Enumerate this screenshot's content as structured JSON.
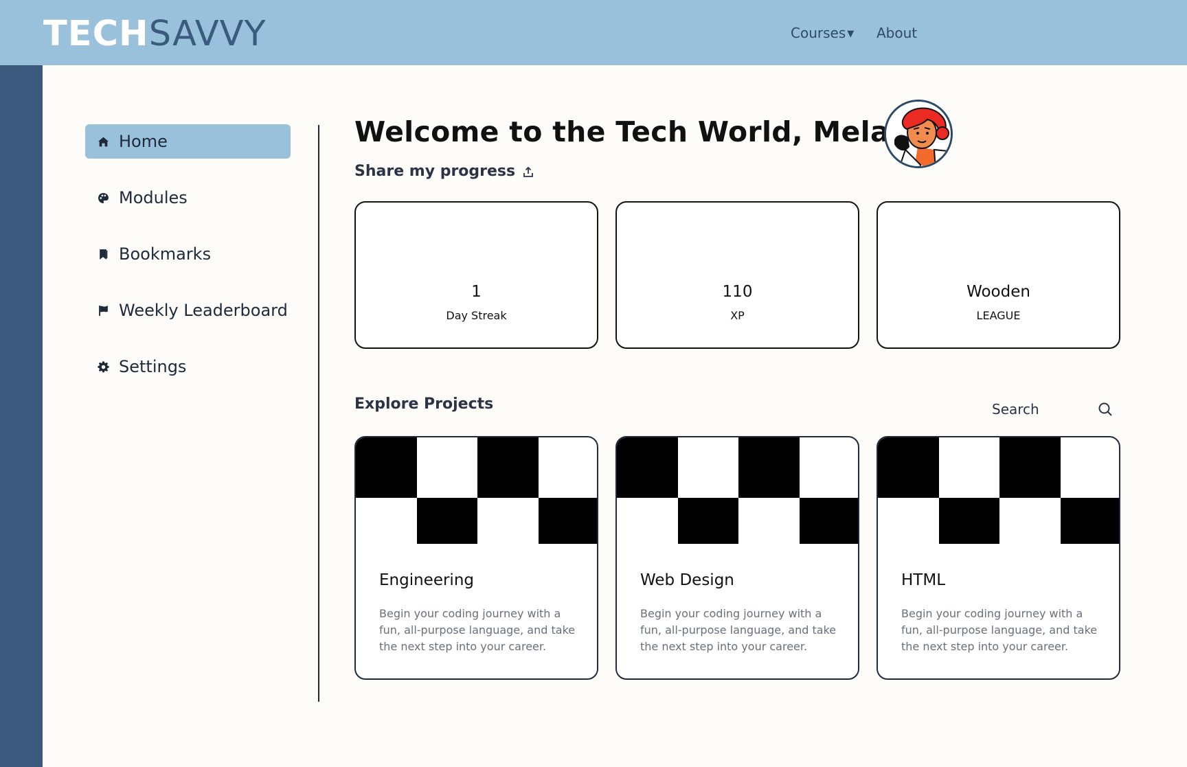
{
  "header": {
    "logo_part1": "TECH",
    "logo_part2": "SAVVY",
    "nav": {
      "courses": "Courses",
      "about": "About"
    }
  },
  "sidebar": {
    "items": [
      {
        "label": "Home",
        "icon": "home-icon"
      },
      {
        "label": "Modules",
        "icon": "palette-icon"
      },
      {
        "label": "Bookmarks",
        "icon": "bookmark-icon"
      },
      {
        "label": "Weekly Leaderboard",
        "icon": "flag-icon"
      },
      {
        "label": "Settings",
        "icon": "gear-icon"
      }
    ]
  },
  "main": {
    "welcome": "Welcome to the Tech World, Melanie!",
    "share_label": "Share my progress",
    "stats": [
      {
        "value": "1",
        "label": "Day Streak"
      },
      {
        "value": "110",
        "label": "XP"
      },
      {
        "value": "Wooden",
        "label": "LEAGUE"
      }
    ],
    "explore_title": "Explore Projects",
    "search_placeholder": "Search",
    "projects": [
      {
        "title": "Engineering",
        "description": "Begin your coding journey with a fun, all-purpose language, and take the next step into your career."
      },
      {
        "title": "Web Design",
        "description": "Begin your coding journey with a fun, all-purpose language, and take the next step into your career."
      },
      {
        "title": "HTML",
        "description": "Begin your coding journey with a fun, all-purpose language, and take the next step into your career."
      }
    ]
  },
  "colors": {
    "topbar": "#9ac1db",
    "left_strip": "#3b5a7d",
    "active_item": "#9ac1db",
    "background": "#fdfcf8"
  }
}
